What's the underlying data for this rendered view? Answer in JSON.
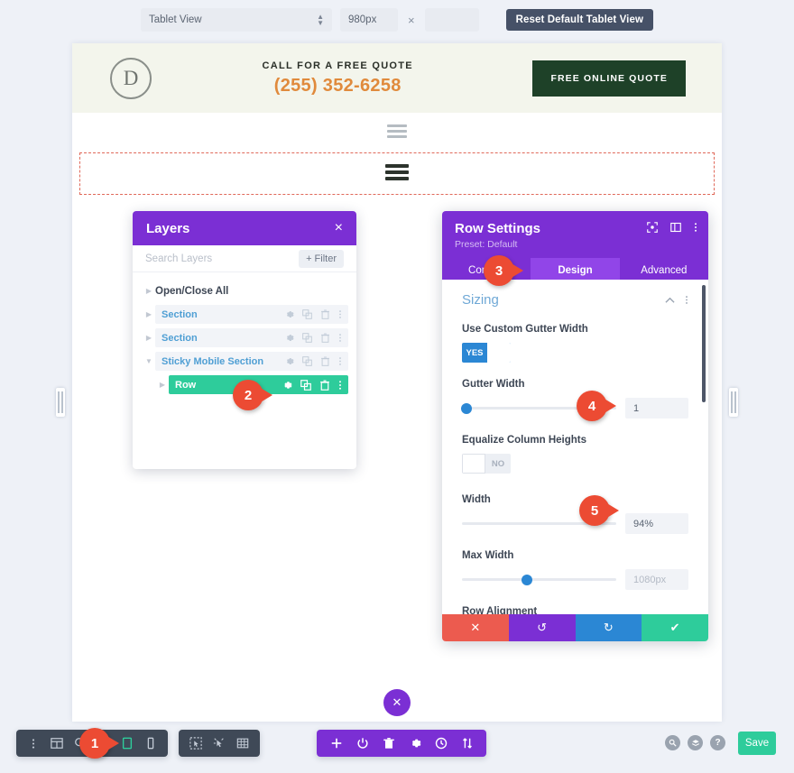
{
  "topbar": {
    "viewport_select": "Tablet View",
    "width_value": "980px",
    "times_symbol": "×",
    "height_value": "",
    "reset_button": "Reset Default Tablet View"
  },
  "site_header": {
    "logo_letter": "D",
    "call_text": "CALL FOR A FREE QUOTE",
    "phone": "(255) 352-6258",
    "quote_button": "FREE ONLINE QUOTE"
  },
  "layers_panel": {
    "title": "Layers",
    "close_label": "×",
    "search_placeholder": "Search Layers",
    "filter_button": "+ Filter",
    "open_close_all": "Open/Close All",
    "items": [
      {
        "label": "Section",
        "selected": false
      },
      {
        "label": "Section",
        "selected": false
      },
      {
        "label": "Sticky Mobile Section",
        "selected": false
      },
      {
        "label": "Row",
        "selected": true
      }
    ]
  },
  "row_settings": {
    "title": "Row Settings",
    "preset": "Preset: Default",
    "tabs": [
      {
        "label": "Content",
        "active": false
      },
      {
        "label": "Design",
        "active": true
      },
      {
        "label": "Advanced",
        "active": false
      }
    ],
    "section_title": "Sizing",
    "fields": {
      "use_custom_gutter_width": {
        "label": "Use Custom Gutter Width",
        "value": "YES"
      },
      "gutter_width": {
        "label": "Gutter Width",
        "value": "1",
        "slider_pct": 3
      },
      "equalize_column_heights": {
        "label": "Equalize Column Heights",
        "value": "NO"
      },
      "width": {
        "label": "Width",
        "value": "94%",
        "slider_pct": 97
      },
      "max_width": {
        "label": "Max Width",
        "value": "1080px",
        "slider_pct": 42
      },
      "row_alignment": {
        "label": "Row Alignment"
      }
    },
    "actions": [
      {
        "name": "discard",
        "glyph": "✕",
        "color": "#ec5b4f"
      },
      {
        "name": "undo",
        "glyph": "↺",
        "color": "#7b2fd4"
      },
      {
        "name": "redo",
        "glyph": "↻",
        "color": "#2b87d4"
      },
      {
        "name": "save",
        "glyph": "✔",
        "color": "#2ecc9b"
      }
    ]
  },
  "callouts": [
    {
      "number": "1"
    },
    {
      "number": "2"
    },
    {
      "number": "3"
    },
    {
      "number": "4"
    },
    {
      "number": "5"
    }
  ],
  "bottom_bar": {
    "save_button": "Save"
  },
  "colors": {
    "purple": "#7b2fd4",
    "purple_light": "#9145e8",
    "green": "#2ecc9b",
    "blue": "#2b87d4",
    "badge_red": "#ec4b33",
    "dark_slate": "#3f4957",
    "phone_orange": "#e08a3c",
    "quote_green": "#1e4128"
  }
}
